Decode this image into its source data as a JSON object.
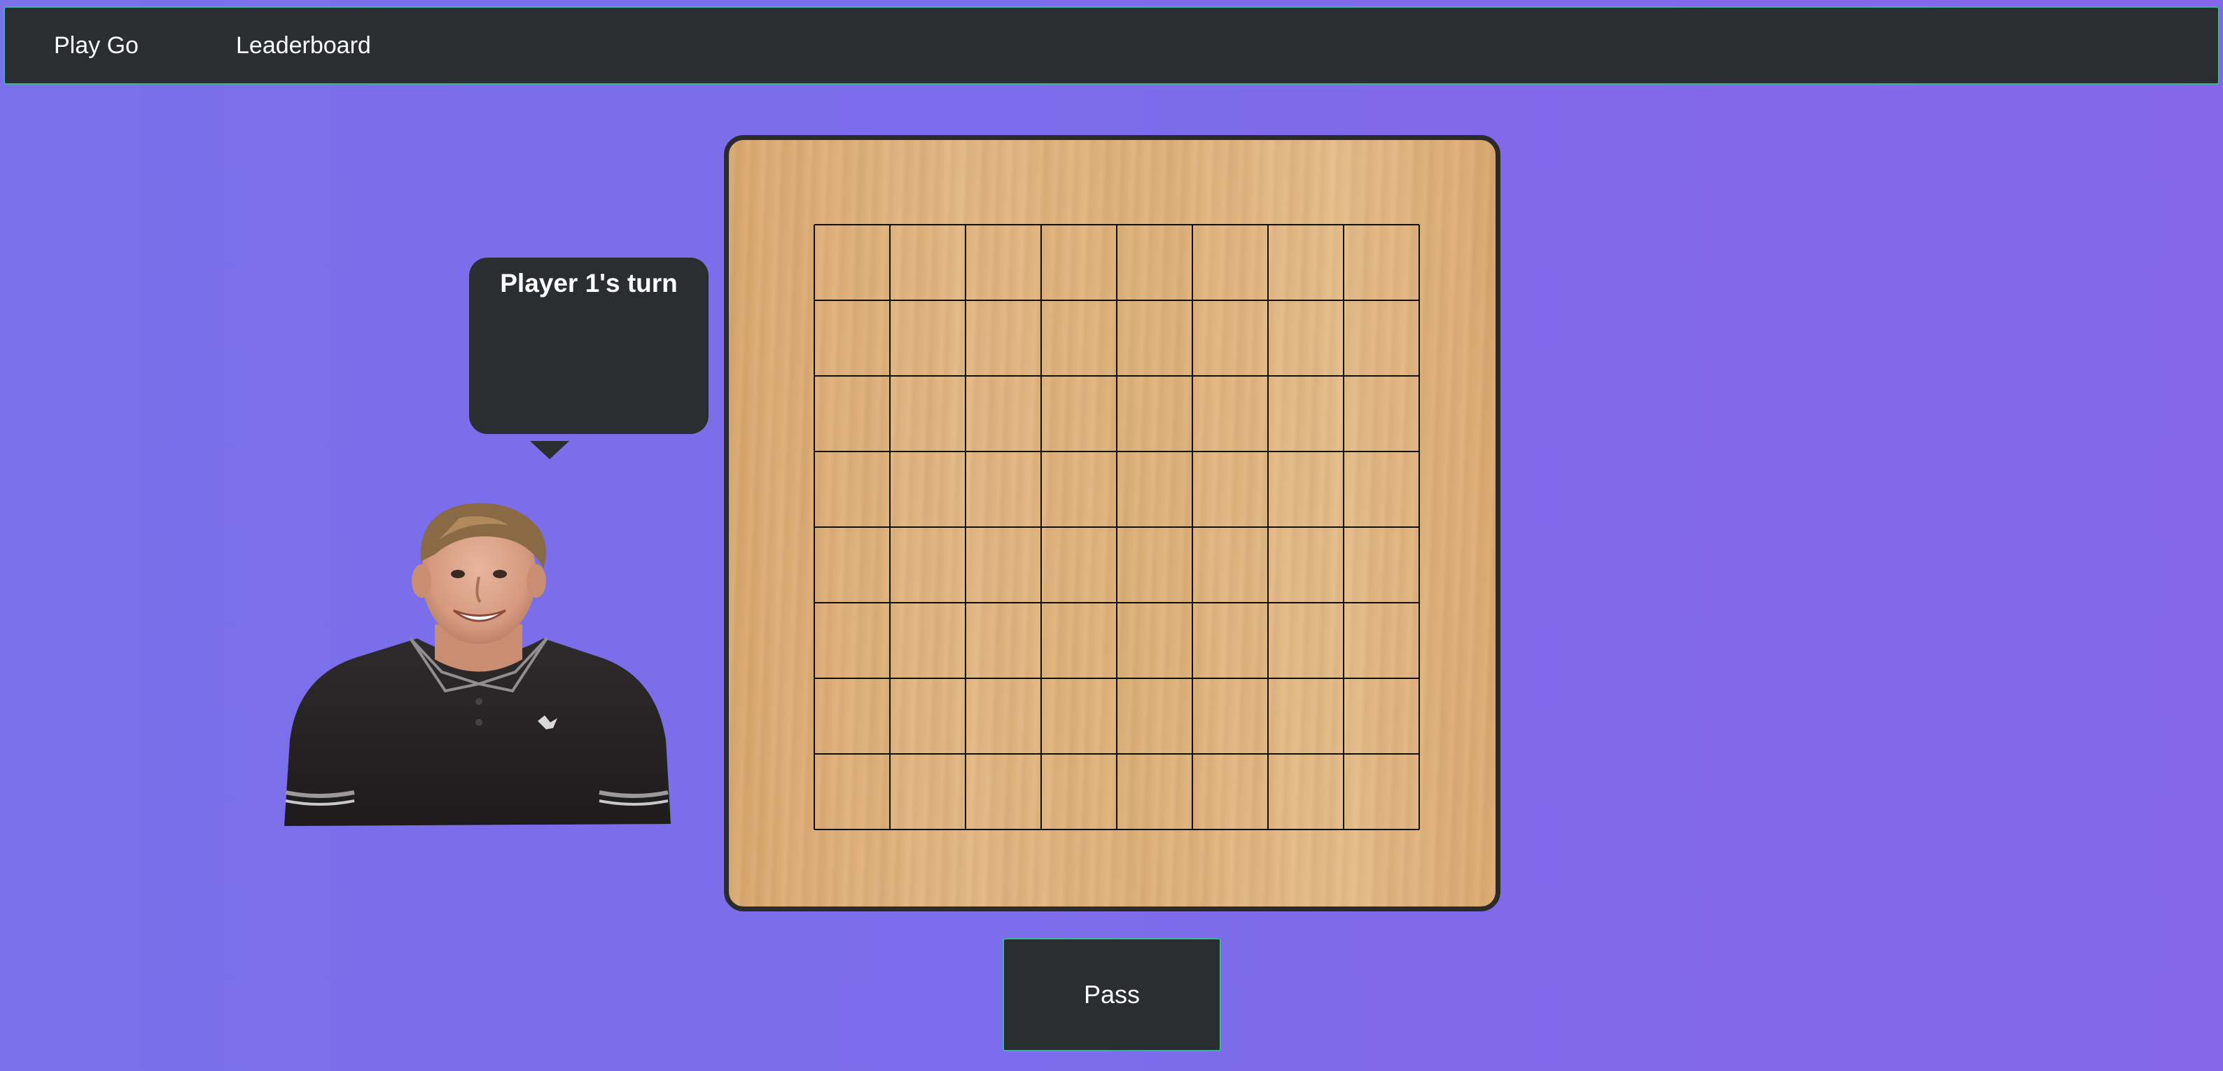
{
  "nav": {
    "items": [
      {
        "label": "Play Go"
      },
      {
        "label": "Leaderboard"
      }
    ]
  },
  "status": {
    "turn_text": "Player 1's turn"
  },
  "board": {
    "grid_cells": 8,
    "line_color": "#111111",
    "frame_color": "#2b2b2b",
    "wood_color": "#e0b27b"
  },
  "player": {
    "avatar_icon": "player-photo"
  },
  "controls": {
    "pass_label": "Pass"
  },
  "colors": {
    "background": "#7d6ceb",
    "panel": "#2a2e30",
    "panel_border": "#3bb59a"
  }
}
